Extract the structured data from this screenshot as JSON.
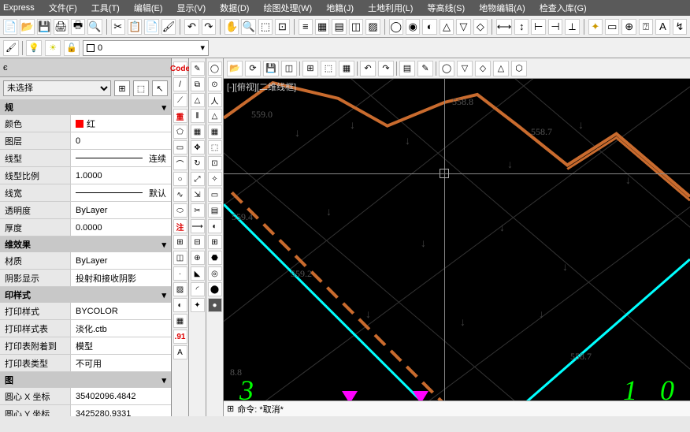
{
  "menu": {
    "express": "Express",
    "file": "文件(F)",
    "tool": "工具(T)",
    "edit": "编辑(E)",
    "view": "显示(V)",
    "data": "数据(D)",
    "drawproc": "绘图处理(W)",
    "cadastre": "地籍(J)",
    "landuse": "土地利用(L)",
    "contour": "等高线(S)",
    "featureedit": "地物编辑(A)",
    "checkin": "检查入库(G)"
  },
  "layerbar": {
    "layer0": "0"
  },
  "props": {
    "header": "未选择",
    "sec_general": "规",
    "color_k": "颜色",
    "color_v": "红",
    "layer_k": "图层",
    "layer_v": "0",
    "ltype_k": "线型",
    "ltype_v": "连续",
    "lscale_k": "线型比例",
    "lscale_v": "1.0000",
    "lweight_k": "线宽",
    "lweight_v": "默认",
    "trans_k": "透明度",
    "trans_v": "ByLayer",
    "thick_k": "厚度",
    "thick_v": "0.0000",
    "sec_3d": "维效果",
    "material_k": "材质",
    "material_v": "ByLayer",
    "shadow_k": "阴影显示",
    "shadow_v": "投射和接收阴影",
    "sec_plot": "印样式",
    "pstyle_k": "打印样式",
    "pstyle_v": "BYCOLOR",
    "ptable_k": "打印样式表",
    "ptable_v": "淡化.ctb",
    "pattach_k": "打印表附着到",
    "pattach_v": "模型",
    "ptype_k": "打印表类型",
    "ptype_v": "不可用",
    "sec_view": "图",
    "cx_k": "圆心 X 坐标",
    "cx_v": "35402096.4842",
    "cy_k": "圆心 Y 坐标",
    "cy_v": "3425280.9331"
  },
  "vtool": {
    "code": "Code",
    "chong": "重",
    "zhu": "注",
    "num": ".91"
  },
  "canvas": {
    "viewlabel": "[-][俯视][二维线框]",
    "labels": {
      "a": "559.0",
      "b": "558.8",
      "c": "558.7",
      "d": "559.4",
      "e": "559.2",
      "f": "558.7",
      "g": "8.8",
      "h": "3",
      "i": "1 0"
    },
    "cmd": "命令: *取消*"
  }
}
